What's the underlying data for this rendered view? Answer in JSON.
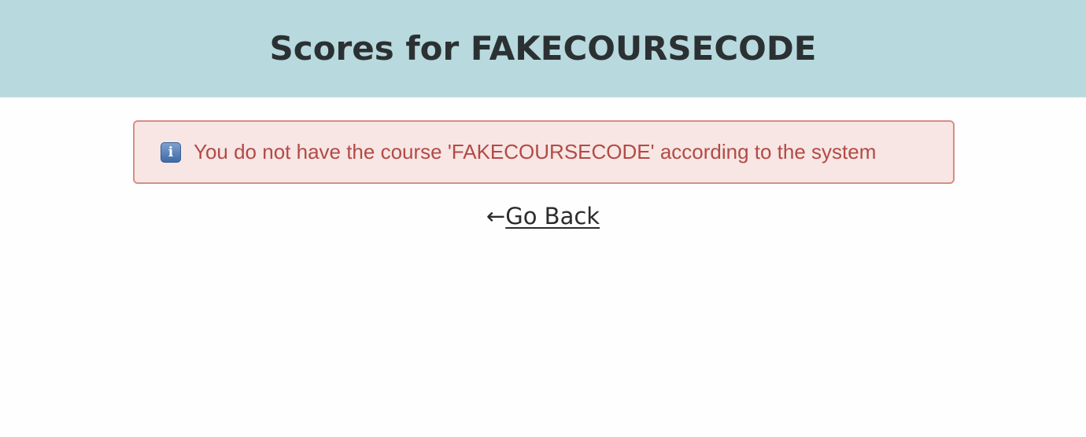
{
  "header": {
    "title": "Scores for FAKECOURSECODE"
  },
  "alert": {
    "icon": "info-icon",
    "icon_glyph": "i",
    "message": "You do not have the course 'FAKECOURSECODE' according to the system"
  },
  "navigation": {
    "back_arrow": "←",
    "back_label": "Go Back"
  },
  "colors": {
    "header_bg": "#b8d9de",
    "alert_bg": "#f7e6e4",
    "alert_border": "#d88d88",
    "alert_text": "#b34a45"
  }
}
